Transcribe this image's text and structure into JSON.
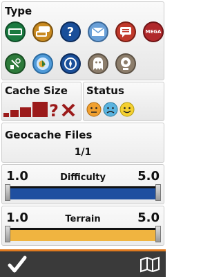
{
  "type_section": {
    "title": "Type",
    "icons": [
      {
        "name": "traditional-cache-icon",
        "color": "#1a7a40"
      },
      {
        "name": "multi-cache-icon",
        "color": "#c98a20"
      },
      {
        "name": "mystery-cache-icon",
        "color": "#1a4f9a"
      },
      {
        "name": "letterbox-cache-icon",
        "color": "#6aa0d8"
      },
      {
        "name": "event-cache-icon",
        "color": "#c0392b"
      },
      {
        "name": "mega-event-icon",
        "color": "#b0282b",
        "label": "MEGA"
      },
      {
        "name": "cito-cache-icon",
        "color": "#2d7a3a"
      },
      {
        "name": "earthcache-icon",
        "color": "#4f9ad8"
      },
      {
        "name": "wherigo-cache-icon",
        "color": "#1a4f9a"
      },
      {
        "name": "virtual-cache-icon",
        "color": "#8c7d6b"
      },
      {
        "name": "webcam-cache-icon",
        "color": "#8c7d6b"
      }
    ]
  },
  "cache_size": {
    "title": "Cache Size",
    "color": "#9b1a1a"
  },
  "status": {
    "title": "Status",
    "faces": [
      "status-not-found-face-icon",
      "status-sad-face-icon",
      "status-happy-face-icon"
    ]
  },
  "geocache_files": {
    "title": "Geocache Files",
    "count": "1/1"
  },
  "difficulty": {
    "min": "1.0",
    "max": "5.0",
    "label": "Difficulty",
    "color": "#1f4fa0"
  },
  "terrain": {
    "min": "1.0",
    "max": "5.0",
    "label": "Terrain",
    "color": "#f0b440"
  },
  "accent_color": "#e07a1f"
}
